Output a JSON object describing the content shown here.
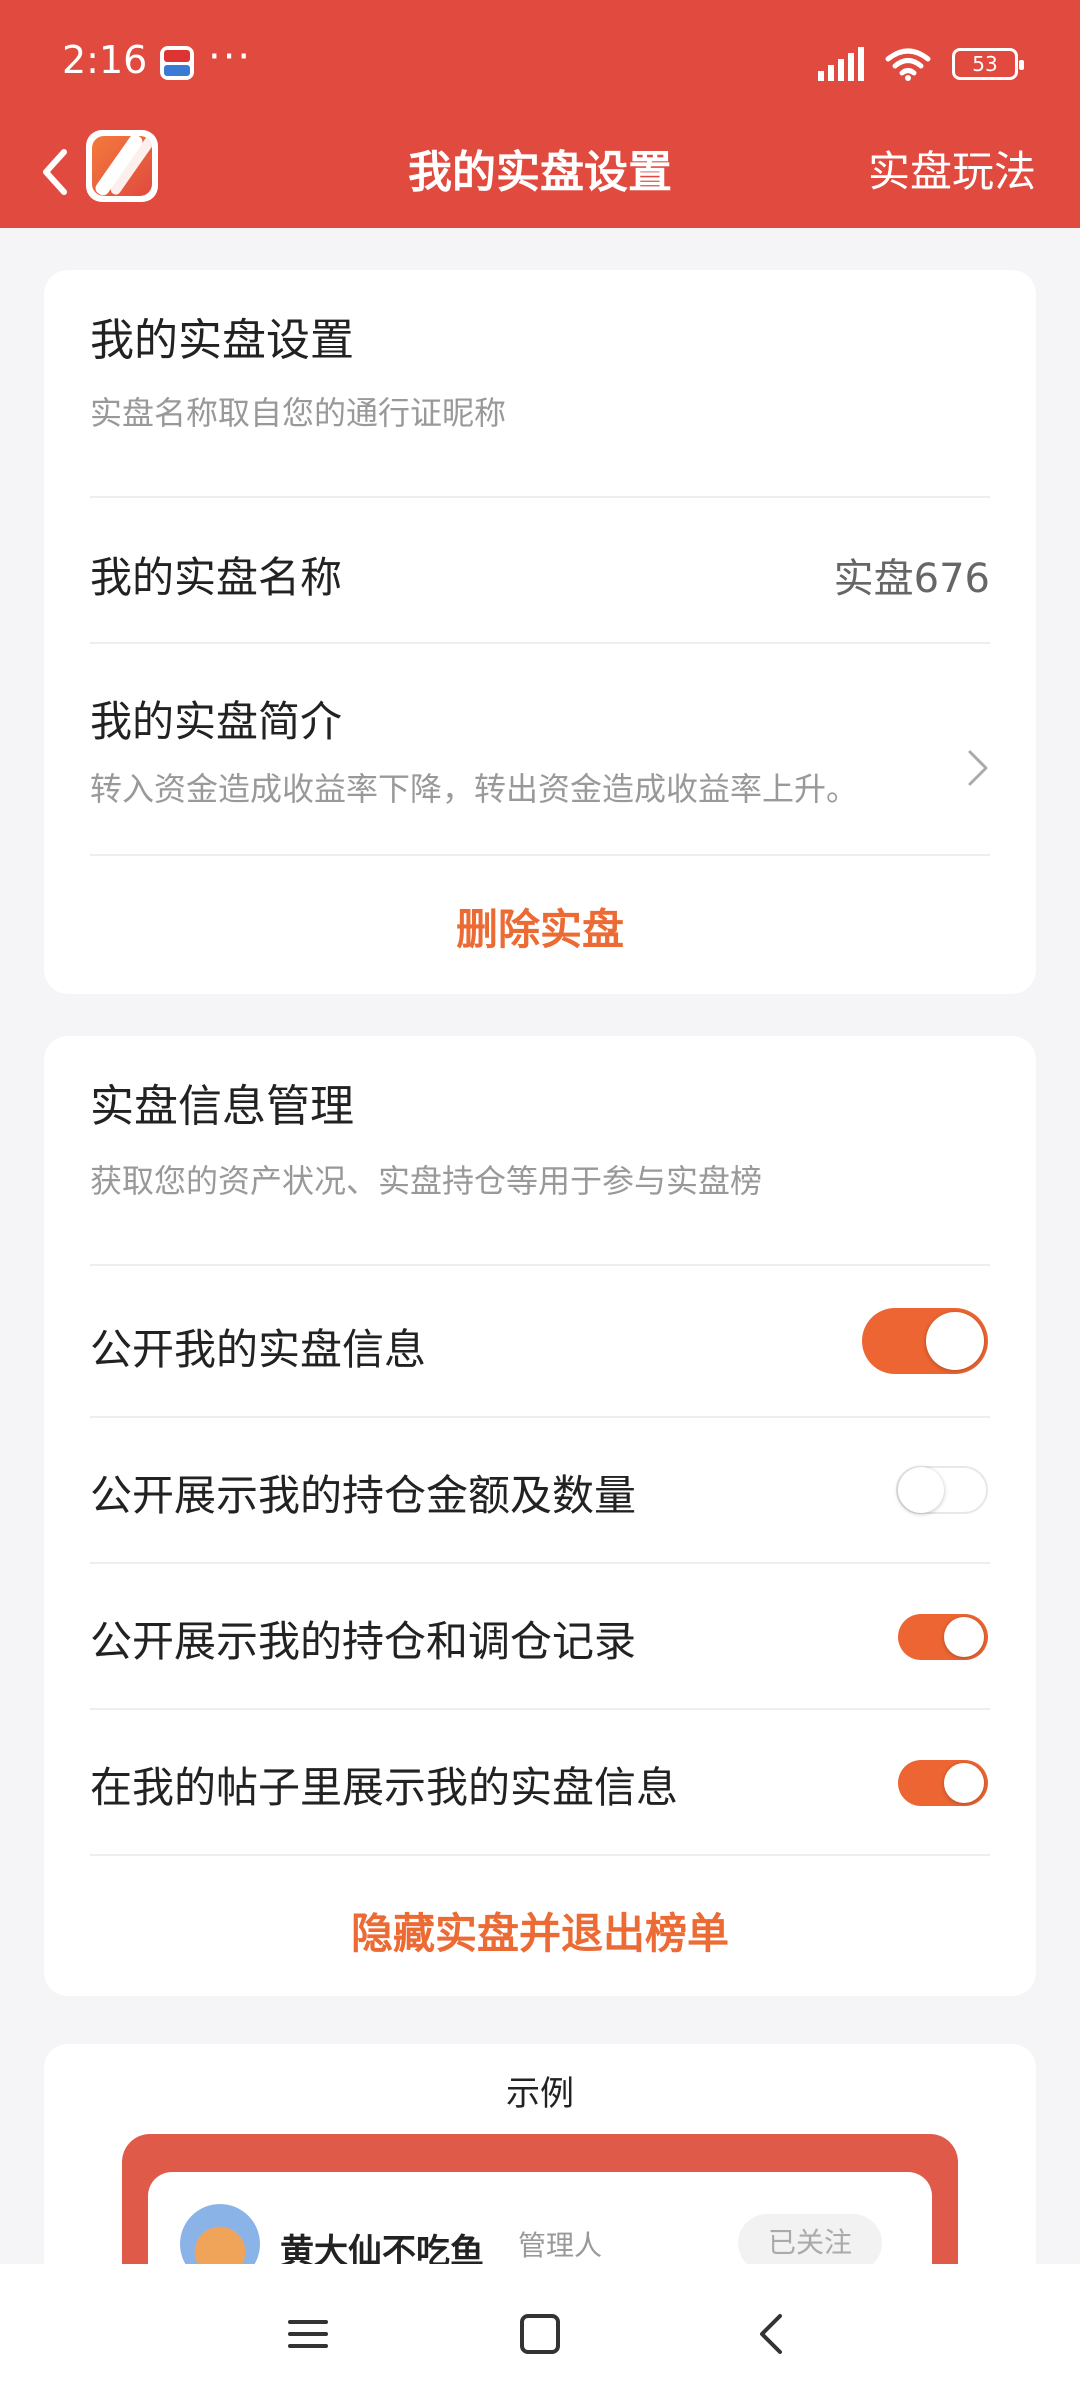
{
  "status": {
    "time": "2:16",
    "dots": "···",
    "battery": "53"
  },
  "navbar": {
    "title": "我的实盘设置",
    "right_link": "实盘玩法"
  },
  "settings_card": {
    "title": "我的实盘设置",
    "subtitle": "实盘名称取自您的通行证昵称",
    "name_label": "我的实盘名称",
    "name_value": "实盘676",
    "intro_label": "我的实盘简介",
    "intro_value": "转入资金造成收益率下降，转出资金造成收益率上升。",
    "delete_label": "删除实盘"
  },
  "info_card": {
    "title": "实盘信息管理",
    "subtitle": "获取您的资产状况、实盘持仓等用于参与实盘榜",
    "toggles": [
      {
        "label": "公开我的实盘信息",
        "on": true
      },
      {
        "label": "公开展示我的持仓金额及数量",
        "on": false
      },
      {
        "label": "公开展示我的持仓和调仓记录",
        "on": true
      },
      {
        "label": "在我的帖子里展示我的实盘信息",
        "on": true
      }
    ],
    "hide_label": "隐藏实盘并退出榜单"
  },
  "sample_card": {
    "title": "示例",
    "user_name": "黄大仙不吃鱼",
    "user_role": "管理人",
    "follow_label": "已关注"
  },
  "colors": {
    "brand": "#e04a3f",
    "accent": "#ec6532",
    "text_secondary": "#999999"
  }
}
